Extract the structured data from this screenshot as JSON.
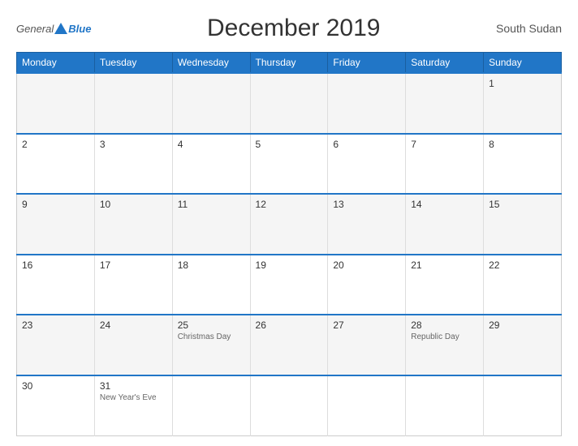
{
  "header": {
    "logo_general": "General",
    "logo_blue": "Blue",
    "title": "December 2019",
    "country": "South Sudan"
  },
  "days": [
    "Monday",
    "Tuesday",
    "Wednesday",
    "Thursday",
    "Friday",
    "Saturday",
    "Sunday"
  ],
  "weeks": [
    [
      {
        "num": "",
        "holiday": ""
      },
      {
        "num": "",
        "holiday": ""
      },
      {
        "num": "",
        "holiday": ""
      },
      {
        "num": "",
        "holiday": ""
      },
      {
        "num": "",
        "holiday": ""
      },
      {
        "num": "",
        "holiday": ""
      },
      {
        "num": "1",
        "holiday": ""
      }
    ],
    [
      {
        "num": "2",
        "holiday": ""
      },
      {
        "num": "3",
        "holiday": ""
      },
      {
        "num": "4",
        "holiday": ""
      },
      {
        "num": "5",
        "holiday": ""
      },
      {
        "num": "6",
        "holiday": ""
      },
      {
        "num": "7",
        "holiday": ""
      },
      {
        "num": "8",
        "holiday": ""
      }
    ],
    [
      {
        "num": "9",
        "holiday": ""
      },
      {
        "num": "10",
        "holiday": ""
      },
      {
        "num": "11",
        "holiday": ""
      },
      {
        "num": "12",
        "holiday": ""
      },
      {
        "num": "13",
        "holiday": ""
      },
      {
        "num": "14",
        "holiday": ""
      },
      {
        "num": "15",
        "holiday": ""
      }
    ],
    [
      {
        "num": "16",
        "holiday": ""
      },
      {
        "num": "17",
        "holiday": ""
      },
      {
        "num": "18",
        "holiday": ""
      },
      {
        "num": "19",
        "holiday": ""
      },
      {
        "num": "20",
        "holiday": ""
      },
      {
        "num": "21",
        "holiday": ""
      },
      {
        "num": "22",
        "holiday": ""
      }
    ],
    [
      {
        "num": "23",
        "holiday": ""
      },
      {
        "num": "24",
        "holiday": ""
      },
      {
        "num": "25",
        "holiday": "Christmas Day"
      },
      {
        "num": "26",
        "holiday": ""
      },
      {
        "num": "27",
        "holiday": ""
      },
      {
        "num": "28",
        "holiday": "Republic Day"
      },
      {
        "num": "29",
        "holiday": ""
      }
    ],
    [
      {
        "num": "30",
        "holiday": ""
      },
      {
        "num": "31",
        "holiday": "New Year's Eve"
      },
      {
        "num": "",
        "holiday": ""
      },
      {
        "num": "",
        "holiday": ""
      },
      {
        "num": "",
        "holiday": ""
      },
      {
        "num": "",
        "holiday": ""
      },
      {
        "num": "",
        "holiday": ""
      }
    ]
  ]
}
